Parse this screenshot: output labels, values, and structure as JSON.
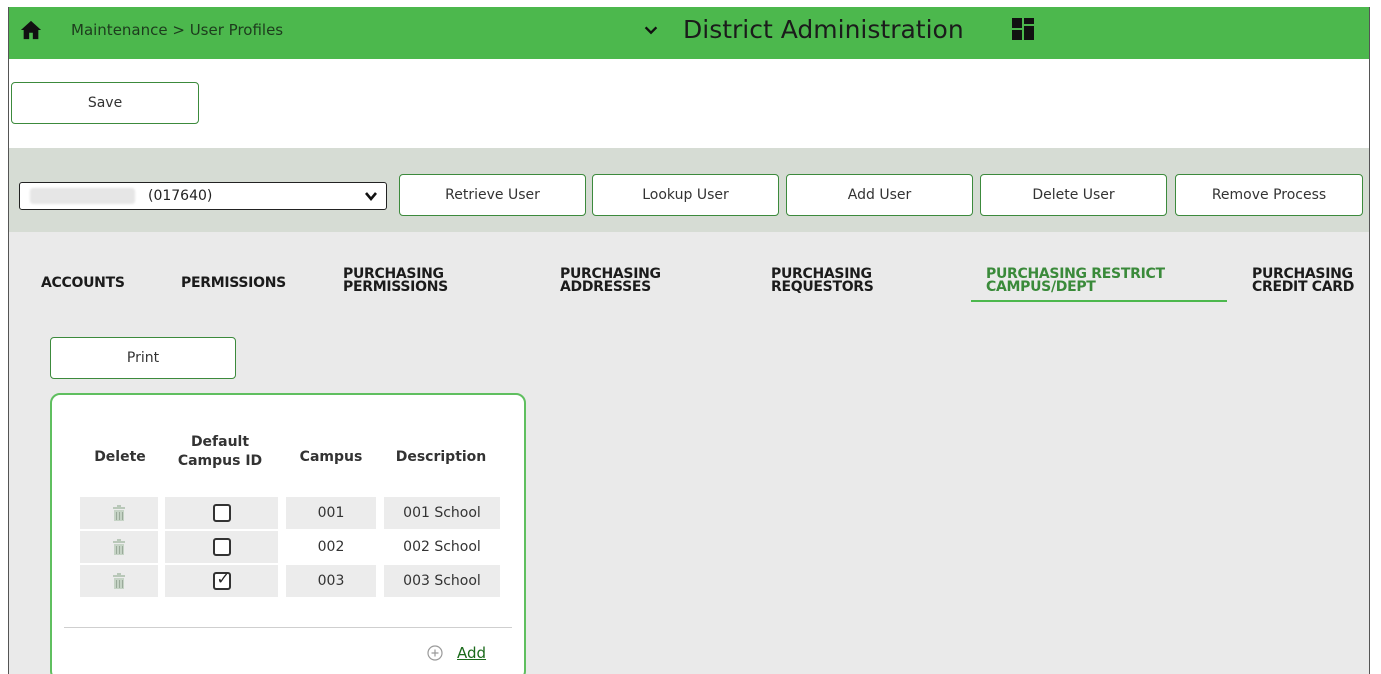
{
  "header": {
    "breadcrumb": "Maintenance > User Profiles",
    "app_title": "District Administration",
    "bg_color": "#4cb84d"
  },
  "toolbar": {
    "save_label": "Save"
  },
  "user_bar": {
    "selected_user_id": "(017640)",
    "buttons": [
      "Retrieve User",
      "Lookup User",
      "Add User",
      "Delete User",
      "Remove Process"
    ]
  },
  "tabs": [
    {
      "label": "ACCOUNTS",
      "active": false
    },
    {
      "label": "PERMISSIONS",
      "active": false
    },
    {
      "label": "PURCHASING\nPERMISSIONS",
      "active": false
    },
    {
      "label": "PURCHASING\nADDRESSES",
      "active": false
    },
    {
      "label": "PURCHASING\nREQUESTORS",
      "active": false
    },
    {
      "label": "PURCHASING RESTRICT\nCAMPUS/DEPT",
      "active": true
    },
    {
      "label": "PURCHASING\nCREDIT CARD",
      "active": false
    }
  ],
  "print_label": "Print",
  "table": {
    "headers": [
      "Delete",
      "Default\nCampus ID",
      "Campus",
      "Description"
    ],
    "rows": [
      {
        "campus": "001",
        "description": "001 School",
        "default": false
      },
      {
        "campus": "002",
        "description": "002 School",
        "default": false
      },
      {
        "campus": "003",
        "description": "003 School",
        "default": true
      }
    ],
    "add_label": "Add"
  },
  "icons": {
    "home": "home-icon",
    "chevron": "chevron-down-icon",
    "grid": "grid-icon",
    "trash": "trash-icon",
    "add": "plus-circle-icon"
  }
}
